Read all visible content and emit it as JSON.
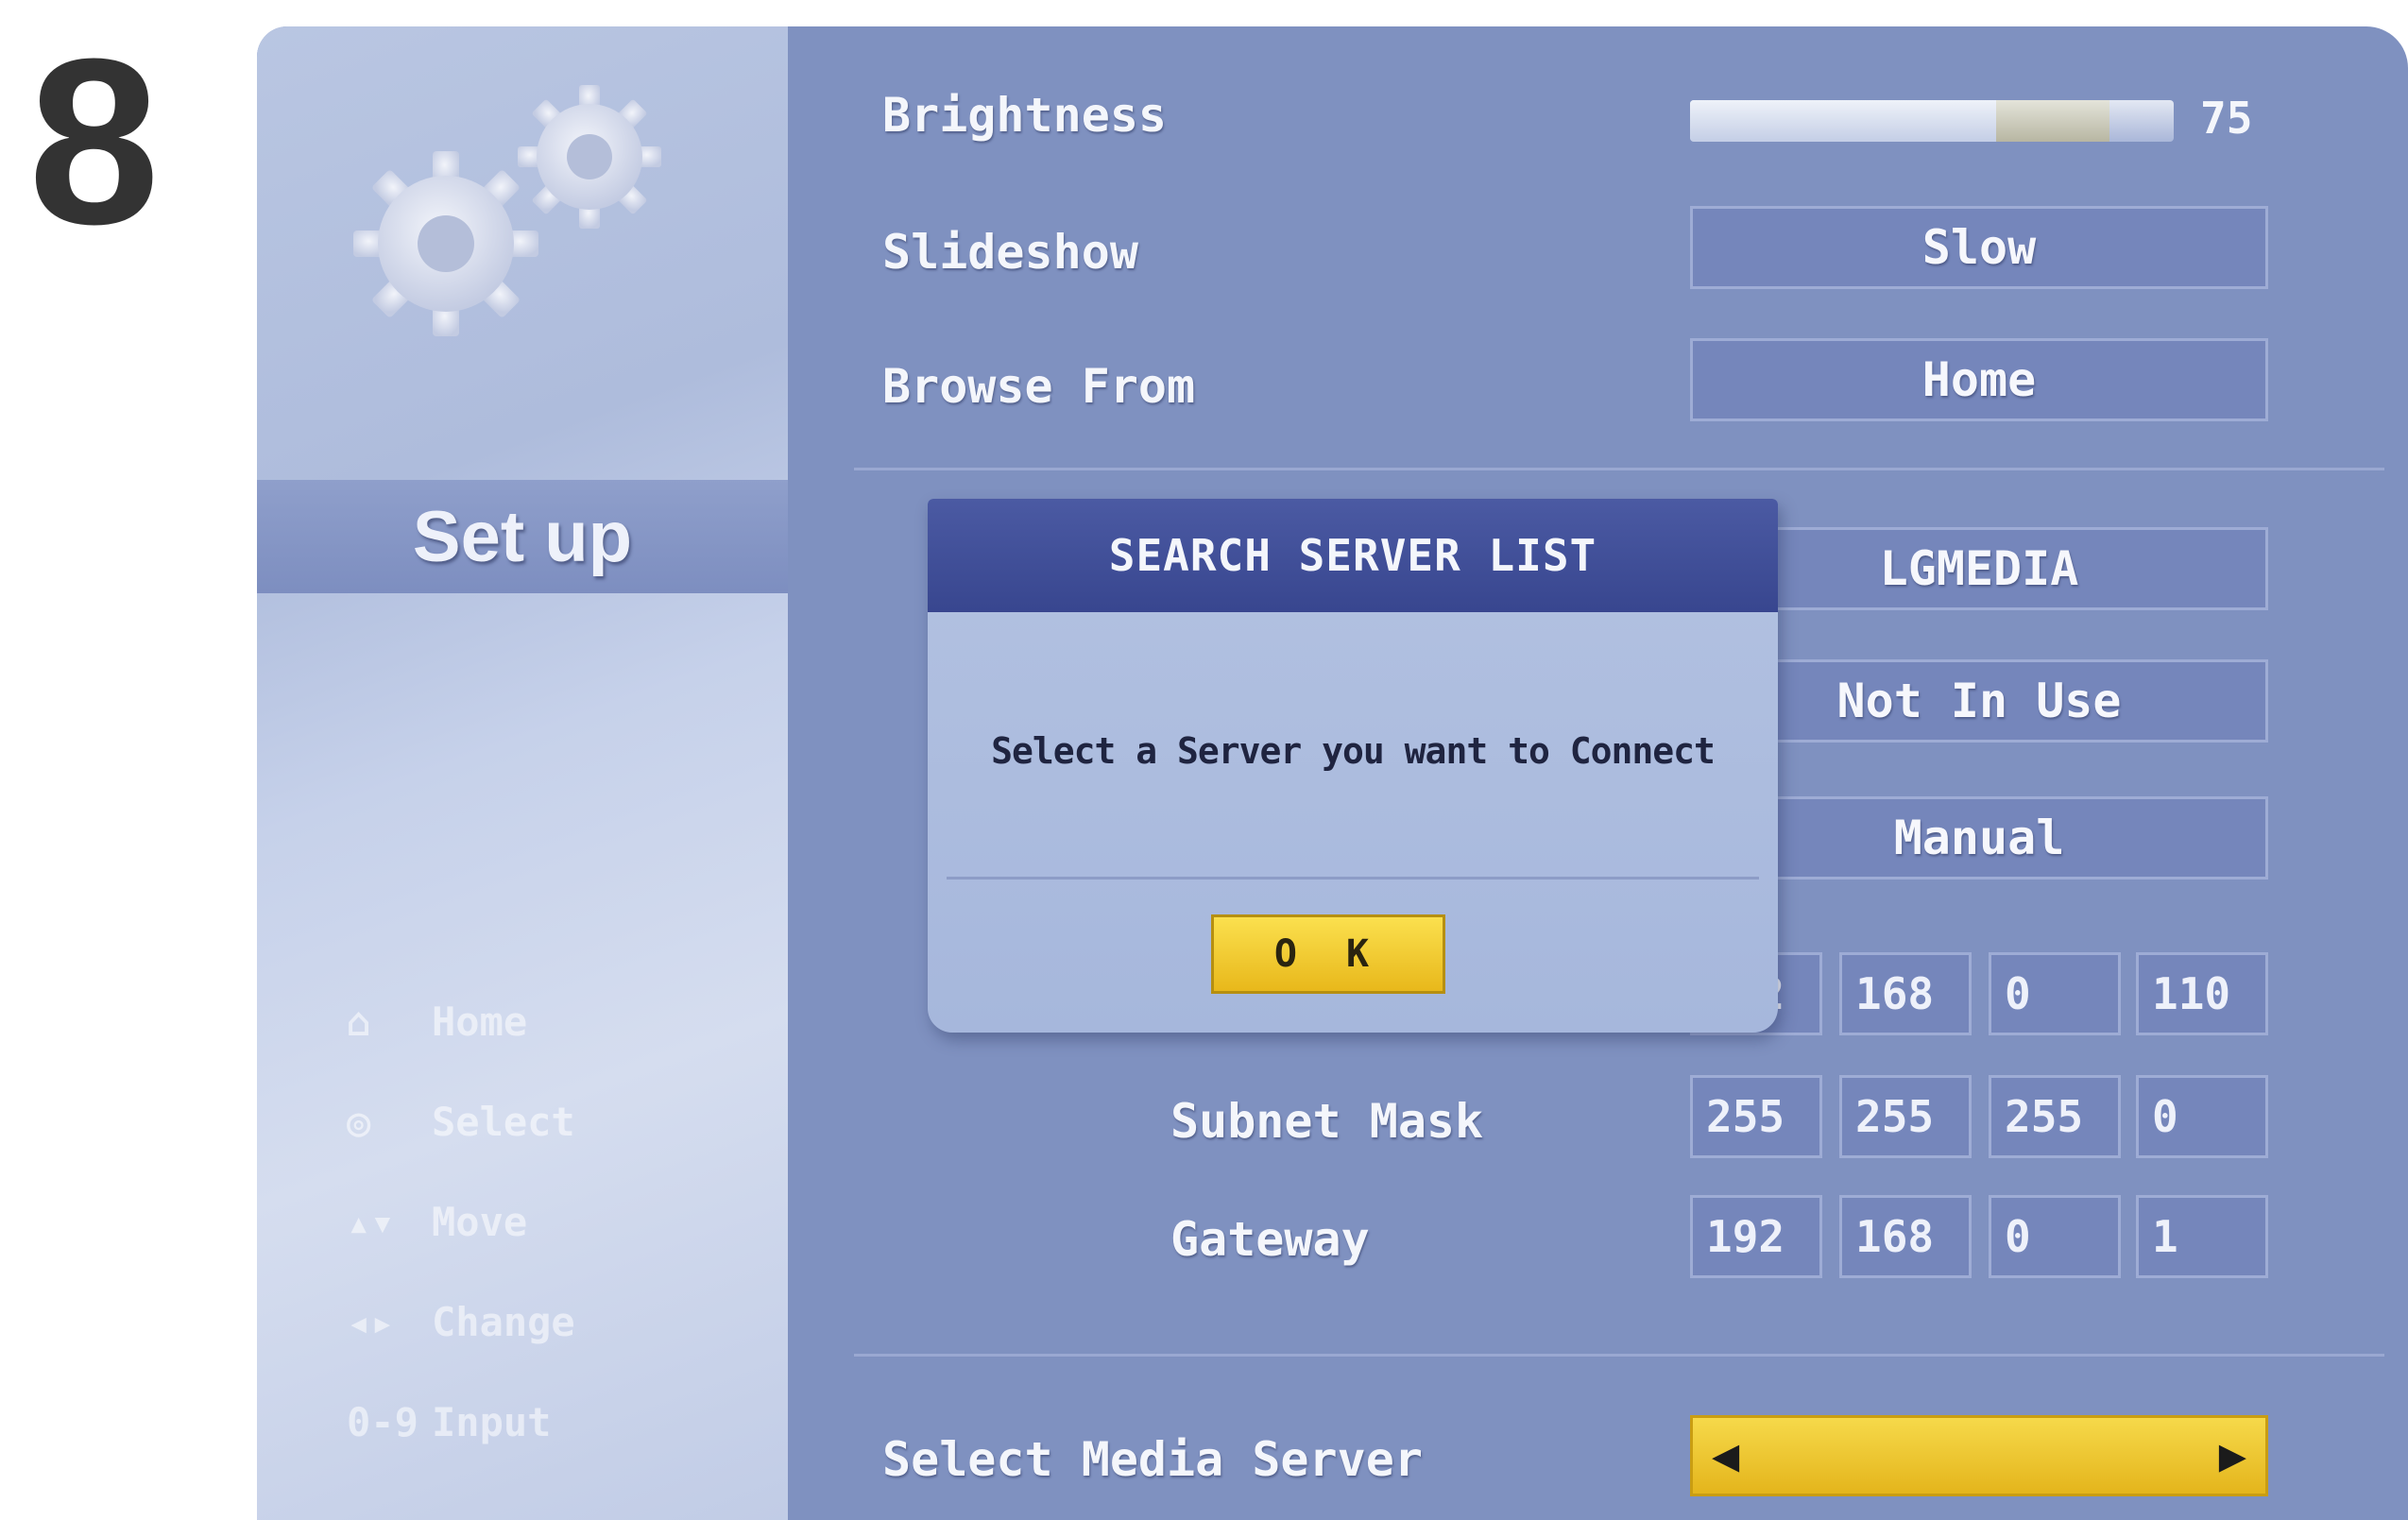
{
  "step": {
    "number": "8"
  },
  "sidebar": {
    "title": "Set up",
    "legend": [
      {
        "icon": "home-icon",
        "glyph": "⌂",
        "label": "Home"
      },
      {
        "icon": "select-icon",
        "glyph": "◎",
        "label": "Select"
      },
      {
        "icon": "move-icon",
        "glyph": "▴▾",
        "label": "Move"
      },
      {
        "icon": "change-icon",
        "glyph": "◂▸",
        "label": "Change"
      },
      {
        "icon": "input-icon",
        "glyph": "0-9",
        "label": "Input"
      }
    ]
  },
  "settings": {
    "brightness": {
      "label": "Brightness",
      "value": "75",
      "level": 0.75
    },
    "slideshow": {
      "label": "Slideshow",
      "value": "Slow"
    },
    "browse_from": {
      "label": "Browse From",
      "value": "Home"
    },
    "server_name": {
      "value": "LGMEDIA"
    },
    "dhcp": {
      "value": "Not In Use"
    },
    "ip_mode": {
      "value": "Manual"
    },
    "ip_address": {
      "values": [
        "192",
        "168",
        "0",
        "110"
      ]
    },
    "subnet_mask": {
      "label": "Subnet Mask",
      "values": [
        "255",
        "255",
        "255",
        "0"
      ]
    },
    "gateway": {
      "label": "Gateway",
      "values": [
        "192",
        "168",
        "0",
        "1"
      ]
    },
    "media_server": {
      "label": "Select Media Server",
      "value": ""
    }
  },
  "dialog": {
    "title": "SEARCH SERVER LIST",
    "message": "Select a Server you want to Connect",
    "ok_label": "O K"
  },
  "colors": {
    "panel": "#7f91c0",
    "dialog_header": "#3f4d96",
    "accent_yellow": "#f2cc35"
  }
}
